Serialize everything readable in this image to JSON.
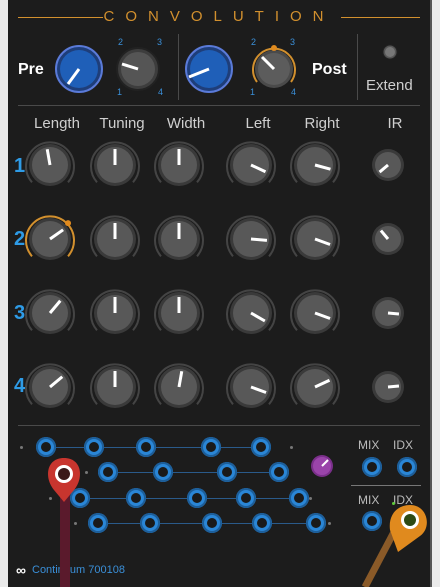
{
  "header": {
    "title": "CONVOLUTION"
  },
  "top": {
    "pre_label": "Pre",
    "post_label": "Post",
    "extend_label": "Extend",
    "scale_pre": [
      "2",
      "3",
      "1",
      "4"
    ],
    "scale_post": [
      "2",
      "3",
      "1",
      "4"
    ]
  },
  "columns": [
    "Length",
    "Tuning",
    "Width",
    "Left",
    "Right",
    "IR"
  ],
  "rows": [
    "1",
    "2",
    "3",
    "4"
  ],
  "io": {
    "mix_top": "MIX",
    "idx_top": "IDX",
    "mix_bottom": "MIX",
    "idx_bottom": "IDX"
  },
  "footer": {
    "logo": "∞",
    "label": "Continuum 700108"
  },
  "colors": {
    "accent": "#d2902e",
    "jack": "#2a86d6",
    "label": "#2e9be6",
    "cable_red": "#c8352e",
    "cable_orange": "#e08a1e"
  }
}
